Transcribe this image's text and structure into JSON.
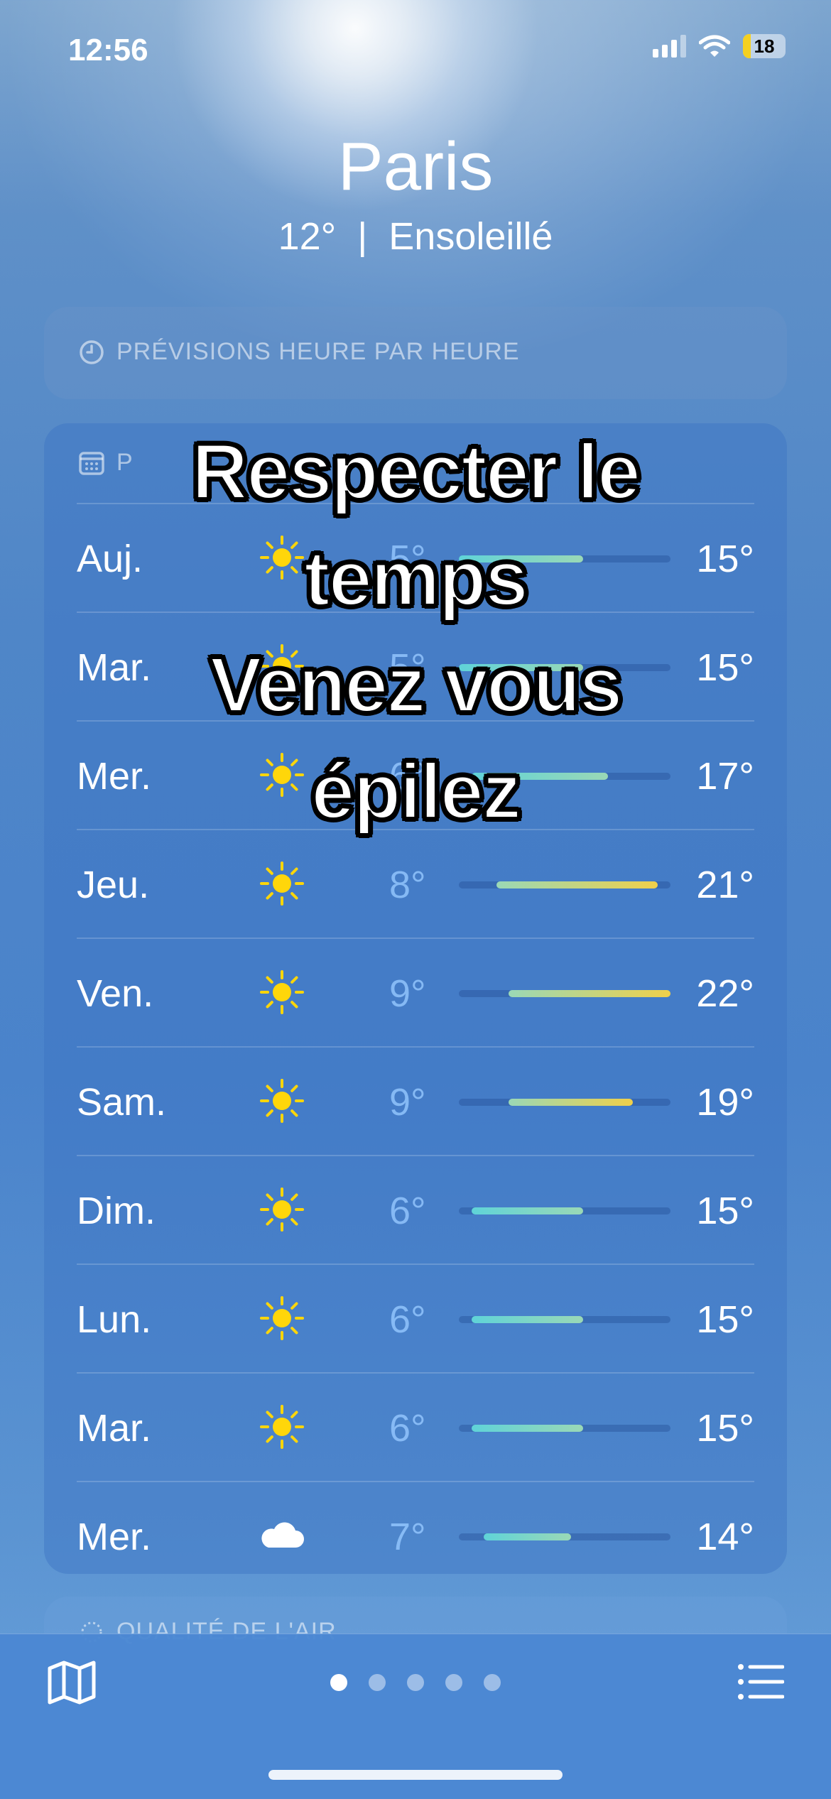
{
  "status_bar": {
    "time": "12:56",
    "battery": "18",
    "battery_level": 0.18
  },
  "location": {
    "city": "Paris",
    "summary": "12°  |  Ensoleillé"
  },
  "hourly": {
    "title": "PRÉVISIONS HEURE PAR HEURE",
    "icon": "clock-icon"
  },
  "forecast": {
    "title": "P",
    "icon": "calendar-icon",
    "scale": {
      "min": 5,
      "max": 22
    },
    "days": [
      {
        "day": "Auj.",
        "icon": "sun",
        "low": "5°",
        "high": "15°",
        "low_value": 5,
        "high_value": 15
      },
      {
        "day": "Mar.",
        "icon": "sun",
        "low": "5°",
        "high": "15°",
        "low_value": 5,
        "high_value": 15
      },
      {
        "day": "Mer.",
        "icon": "sun",
        "low": "6°",
        "high": "17°",
        "low_value": 6,
        "high_value": 17
      },
      {
        "day": "Jeu.",
        "icon": "sun",
        "low": "8°",
        "high": "21°",
        "low_value": 8,
        "high_value": 21
      },
      {
        "day": "Ven.",
        "icon": "sun",
        "low": "9°",
        "high": "22°",
        "low_value": 9,
        "high_value": 22
      },
      {
        "day": "Sam.",
        "icon": "sun",
        "low": "9°",
        "high": "19°",
        "low_value": 9,
        "high_value": 19
      },
      {
        "day": "Dim.",
        "icon": "sun",
        "low": "6°",
        "high": "15°",
        "low_value": 6,
        "high_value": 15
      },
      {
        "day": "Lun.",
        "icon": "sun",
        "low": "6°",
        "high": "15°",
        "low_value": 6,
        "high_value": 15
      },
      {
        "day": "Mar.",
        "icon": "sun",
        "low": "6°",
        "high": "15°",
        "low_value": 6,
        "high_value": 15
      },
      {
        "day": "Mer.",
        "icon": "cloud",
        "low": "7°",
        "high": "14°",
        "low_value": 7,
        "high_value": 14
      }
    ]
  },
  "air_quality": {
    "title": "QUALITÉ DE L'AIR"
  },
  "overlay": {
    "line1": "Respecter le",
    "line2": "temps",
    "line3": "Venez vous",
    "line4": "épilez"
  },
  "bottom_bar": {
    "pages": 5,
    "active_page": 1,
    "left_icon": "map-icon",
    "right_icon": "list-icon"
  },
  "colors": {
    "cool": "#5fd3d8",
    "mid": "#9ad8b6",
    "warm": "#f0d04a"
  }
}
